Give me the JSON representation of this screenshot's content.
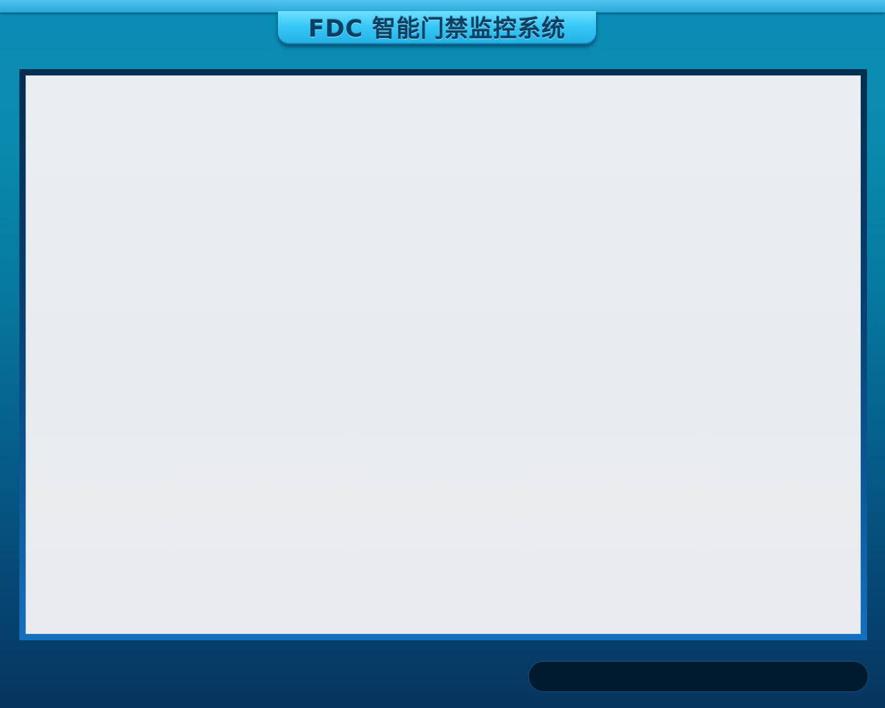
{
  "app": {
    "title": "FDC 智能门禁监控系统"
  },
  "status_bar": {
    "text": ""
  },
  "colors": {
    "background_top": "#0a8db5",
    "background_bottom": "#06355f",
    "title_plate": "#38c8f6",
    "title_text": "#0b3f63",
    "content_panel": "#eaeef1",
    "frame_border": "#0c5a9c",
    "status_bar": "#001a30"
  }
}
